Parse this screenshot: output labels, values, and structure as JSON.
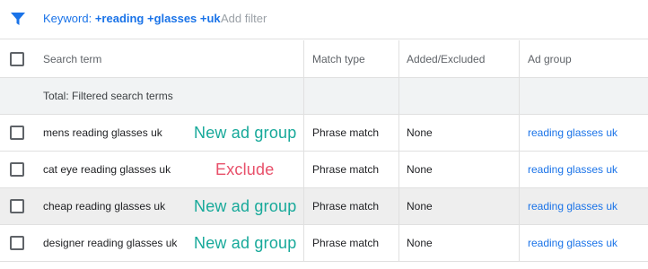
{
  "filter_bar": {
    "icon": "filter-icon",
    "keyword_label": "Keyword:",
    "keyword_value": "+reading +glasses +uk",
    "add_filter_label": "Add filter"
  },
  "table": {
    "columns": {
      "search_term": "Search term",
      "match_type": "Match type",
      "added_excluded": "Added/Excluded",
      "ad_group": "Ad group"
    },
    "total_label": "Total: Filtered search terms",
    "rows": [
      {
        "term": "mens reading glasses uk",
        "annotation": "New ad group",
        "match_type": "Phrase match",
        "added_excluded": "None",
        "ad_group": "reading glasses uk"
      },
      {
        "term": "cat eye reading glasses uk",
        "annotation": "Exclude",
        "match_type": "Phrase match",
        "added_excluded": "None",
        "ad_group": "reading glasses uk"
      },
      {
        "term": "cheap reading glasses uk",
        "annotation": "New ad group",
        "match_type": "Phrase match",
        "added_excluded": "None",
        "ad_group": "reading glasses uk"
      },
      {
        "term": "designer reading glasses uk",
        "annotation": "New ad group",
        "match_type": "Phrase match",
        "added_excluded": "None",
        "ad_group": "reading glasses uk"
      }
    ]
  },
  "colors": {
    "link": "#1a73e8",
    "annotation_new": "#17a99a",
    "annotation_exclude": "#e8506a",
    "total_row_bg": "#f1f3f4",
    "hover_row_bg": "#eeeeee"
  }
}
